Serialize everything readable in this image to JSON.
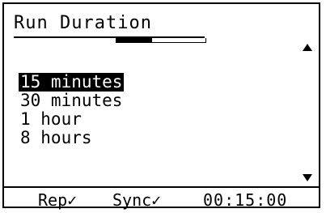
{
  "screen": {
    "title": "Run Duration",
    "scroll_up_icon": "triangle-up",
    "scroll_down_icon": "triangle-down",
    "scroll_position": 0.4
  },
  "options": [
    {
      "label": "15 minutes",
      "selected": true
    },
    {
      "label": "30 minutes",
      "selected": false
    },
    {
      "label": "1 hour",
      "selected": false
    },
    {
      "label": "8 hours",
      "selected": false
    }
  ],
  "status_bar": {
    "rep": "Rep✓",
    "sync": "Sync✓",
    "time": "00:15:00"
  }
}
